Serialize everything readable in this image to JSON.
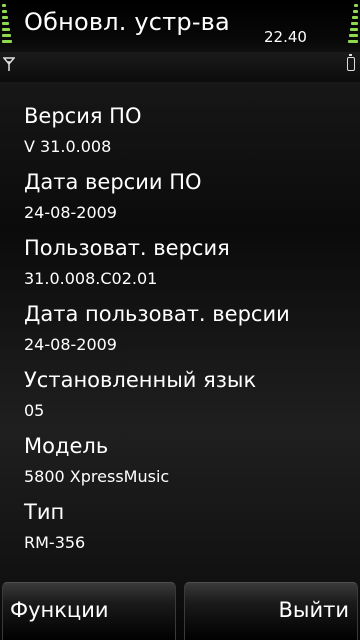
{
  "header": {
    "title": "Обновл. устр-ва",
    "clock": "22.40"
  },
  "status": {
    "signal_icon": "antenna-icon",
    "battery_icon": "battery-icon",
    "accent_color": "#8ed94f"
  },
  "info": {
    "items": [
      {
        "label": "Версия ПО",
        "value": "V 31.0.008"
      },
      {
        "label": "Дата версии ПО",
        "value": "24-08-2009"
      },
      {
        "label": "Пользоват. версия",
        "value": "31.0.008.C02.01"
      },
      {
        "label": "Дата пользоват. версии",
        "value": "24-08-2009"
      },
      {
        "label": "Установленный язык",
        "value": "05"
      },
      {
        "label": "Модель",
        "value": "5800 XpressMusic"
      },
      {
        "label": "Тип",
        "value": "RM-356"
      }
    ]
  },
  "softkeys": {
    "left_label": "Функции",
    "right_label": "Выйти"
  }
}
